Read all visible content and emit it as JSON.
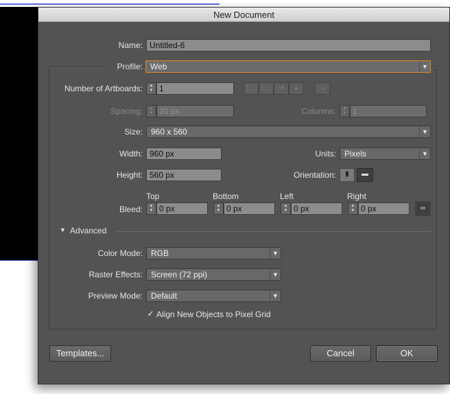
{
  "dialog": {
    "title": "New Document"
  },
  "name": {
    "label": "Name:",
    "value": "Untitled-6"
  },
  "profile": {
    "label": "Profile:",
    "value": "Web"
  },
  "artboards": {
    "label": "Number of Artboards:",
    "value": "1"
  },
  "spacing": {
    "label": "Spacing:",
    "value": "20 px"
  },
  "columns": {
    "label": "Columns:",
    "value": "1"
  },
  "size": {
    "label": "Size:",
    "value": "960 x 560"
  },
  "width": {
    "label": "Width:",
    "value": "960 px"
  },
  "units": {
    "label": "Units:",
    "value": "Pixels"
  },
  "height": {
    "label": "Height:",
    "value": "560 px"
  },
  "orientation": {
    "label": "Orientation:"
  },
  "bleed": {
    "label": "Bleed:",
    "top_label": "Top",
    "top": "0 px",
    "bottom_label": "Bottom",
    "bottom": "0 px",
    "left_label": "Left",
    "left": "0 px",
    "right_label": "Right",
    "right": "0 px"
  },
  "advanced": {
    "label": "Advanced",
    "color_mode": {
      "label": "Color Mode:",
      "value": "RGB"
    },
    "raster_effects": {
      "label": "Raster Effects:",
      "value": "Screen (72 ppi)"
    },
    "preview_mode": {
      "label": "Preview Mode:",
      "value": "Default"
    },
    "align_pixel_grid": {
      "label": "Align New Objects to Pixel Grid",
      "checked": true
    }
  },
  "buttons": {
    "templates": "Templates...",
    "cancel": "Cancel",
    "ok": "OK"
  },
  "icons": {
    "spin": "spinner-arrows-icon",
    "dropdown": "chevron-down-icon",
    "link": "link-chain-icon",
    "portrait": "portrait-orientation-icon",
    "landscape": "landscape-orientation-icon",
    "layout": [
      "grid-by-row-icon",
      "grid-by-column-icon",
      "arrange-by-row-icon",
      "arrange-by-column-icon",
      "right-to-left-icon"
    ]
  },
  "colors": {
    "dialog_bg": "#535353",
    "highlight": "#e58a1f",
    "titlebar": "#dcdcdc"
  }
}
